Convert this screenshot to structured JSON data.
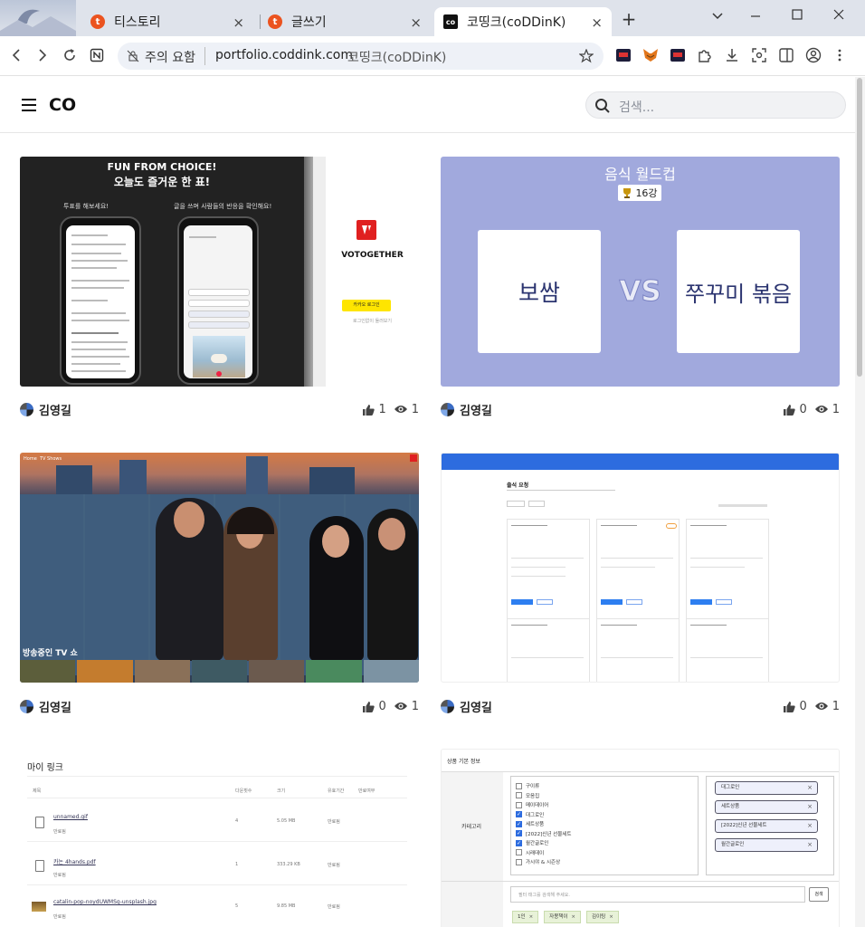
{
  "browser": {
    "tabs": [
      {
        "title": "티스토리",
        "favicon": "tistory-icon"
      },
      {
        "title": "글쓰기",
        "favicon": "tistory-icon"
      },
      {
        "title": "코띵크(coDDinK)",
        "favicon": "coddink-icon",
        "active": true
      }
    ],
    "new_tab": "+",
    "security_label": "주의 요함",
    "url": "portfolio.coddink.com",
    "page_title_in_url": "코띵크(coDDinK)",
    "window_controls": [
      "minimize",
      "maximize",
      "close"
    ]
  },
  "site": {
    "logo": "CO",
    "search_placeholder": "검색..."
  },
  "cards": [
    {
      "author": "김영길",
      "likes": "1",
      "views": "1",
      "preview": {
        "heading1": "FUN FROM CHOICE!",
        "heading2": "오늘도 즐거운 한 표!",
        "left_caption": "투표를 해보세요!",
        "right_caption": "글을 쓰며 사람들의 반응을 확인해요!",
        "brand": "VOTOGETHER",
        "kakao_button": "카카오 로그인",
        "sub_link": "로그인없이 둘러보기"
      }
    },
    {
      "author": "김영길",
      "likes": "0",
      "views": "1",
      "preview": {
        "title": "음식 월드컵",
        "round": "16강",
        "left_choice": "보쌈",
        "vs": "VS",
        "right_choice": "쭈꾸미 볶음"
      }
    },
    {
      "author": "김영길",
      "likes": "0",
      "views": "1",
      "preview": {
        "nav_items": [
          "Home",
          "TV Shows"
        ],
        "row_title": "방송중인 TV 쇼"
      }
    },
    {
      "author": "김영길",
      "likes": "0",
      "views": "1",
      "preview": {
        "page_title": "출석 요청"
      }
    },
    {
      "author": "",
      "likes": "",
      "views": "",
      "preview": {
        "title": "마이 링크",
        "columns": [
          "제목",
          "다운횟수",
          "크기",
          "유효기간",
          "만료여부"
        ],
        "rows": [
          {
            "name": "unnamed.gif",
            "sub": "만료됨",
            "count": "4",
            "size": "5.05 MB",
            "status": "만료됨"
          },
          {
            "name": "카논 4hands.pdf",
            "sub": "만료됨",
            "count": "1",
            "size": "333.29 KB",
            "status": "만료됨"
          },
          {
            "name": "catalin-pop-noydUWMSg-unsplash.jpg",
            "sub": "만료됨",
            "count": "5",
            "size": "9.85 MB",
            "status": "만료됨"
          }
        ]
      }
    },
    {
      "author": "",
      "likes": "",
      "views": "",
      "preview": {
        "section": "상품 기본 정보",
        "field_label": "카테고리",
        "categories": [
          {
            "label": "구이류",
            "checked": false
          },
          {
            "label": "모음집",
            "checked": false
          },
          {
            "label": "메이데이어",
            "checked": false
          },
          {
            "label": "대그로인",
            "checked": true
          },
          {
            "label": "세트상품",
            "checked": true
          },
          {
            "label": "[2022]신년 선물세트",
            "checked": true
          },
          {
            "label": "월간글로인",
            "checked": true
          },
          {
            "label": "시래데이",
            "checked": false
          },
          {
            "label": "가시야 & 시즌상",
            "checked": false
          }
        ],
        "selected_tags": [
          "대그로인",
          "세트상품",
          "[2022]신년 선물세트",
          "월간글로인"
        ],
        "tag_input_placeholder": "필터 태그를 검색해 주세요.",
        "tag_button": "검색",
        "filter_tags": [
          "1인",
          "자몽책이",
          "김이팅"
        ]
      }
    }
  ],
  "colors": {
    "worldcup_bg": "#a1a9dd",
    "worldcup_text": "#2b3470",
    "kakao": "#fee500",
    "vote_red": "#e02020",
    "tag_bg": "#e8f2d8"
  }
}
